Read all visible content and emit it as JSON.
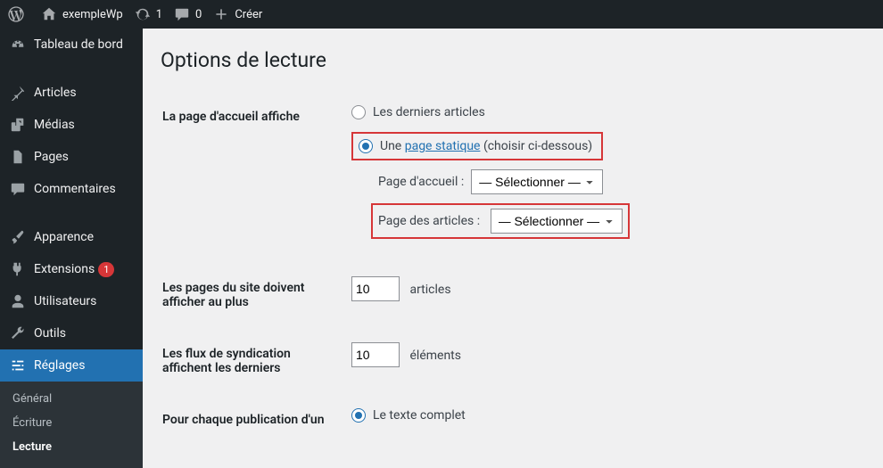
{
  "adminbar": {
    "site_name": "exempleWp",
    "updates": "1",
    "comments": "0",
    "create": "Créer"
  },
  "sidebar": {
    "dashboard": "Tableau de bord",
    "posts": "Articles",
    "media": "Médias",
    "pages": "Pages",
    "comments": "Commentaires",
    "appearance": "Apparence",
    "plugins": "Extensions",
    "plugins_badge": "1",
    "users": "Utilisateurs",
    "tools": "Outils",
    "settings": "Réglages",
    "submenu": {
      "general": "Général",
      "writing": "Écriture",
      "reading": "Lecture"
    }
  },
  "page": {
    "title": "Options de lecture",
    "front_page_displays_label": "La page d'accueil affiche",
    "latest_posts_label": "Les derniers articles",
    "static_page_prefix": "Une ",
    "static_page_link": "page statique",
    "static_page_suffix": " (choisir ci-dessous)",
    "homepage_label": "Page d'accueil :",
    "posts_page_label": "Page des articles :",
    "select_placeholder": "— Sélectionner —",
    "blog_pages_show_label": "Les pages du site doivent afficher au plus",
    "blog_pages_value": "10",
    "blog_pages_unit": "articles",
    "syndication_label": "Les flux de syndication affichent les derniers",
    "syndication_value": "10",
    "syndication_unit": "éléments",
    "feed_content_label": "Pour chaque publication d'un",
    "feed_full_text": "Le texte complet"
  }
}
